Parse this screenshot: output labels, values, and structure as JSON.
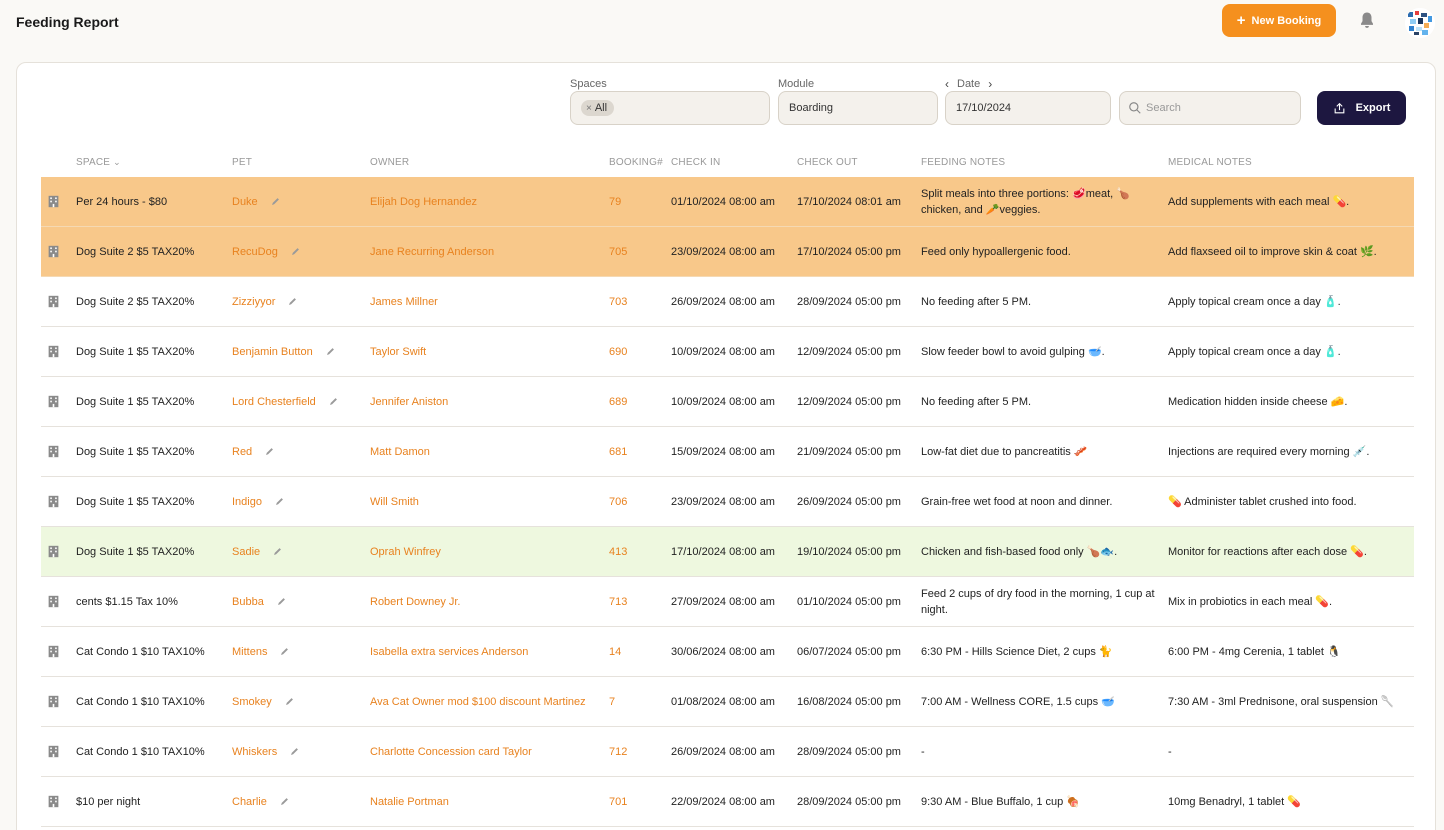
{
  "header": {
    "title": "Feeding Report",
    "new_booking_label": "New Booking"
  },
  "filters": {
    "spaces_label": "Spaces",
    "spaces_chip": "All",
    "module_label": "Module",
    "module_value": "Boarding",
    "date_label": "Date",
    "date_value": "17/10/2024",
    "search_placeholder": "Search",
    "export_label": "Export"
  },
  "columns": {
    "space": "SPACE",
    "pet": "PET",
    "owner": "OWNER",
    "booking": "BOOKING#",
    "check_in": "CHECK IN",
    "check_out": "CHECK OUT",
    "feeding_notes": "FEEDING NOTES",
    "medical_notes": "MEDICAL NOTES"
  },
  "colors": {
    "accent": "#f5901e",
    "link": "#e8821f",
    "export_bg": "#1d1740",
    "row_highlight_orange": "#f8c88a",
    "row_highlight_green": "#eef8df"
  },
  "rows": [
    {
      "space": "Per 24 hours - $80",
      "pet": "Duke",
      "owner": "Elijah Dog Hernandez",
      "booking": "79",
      "check_in": "01/10/2024 08:00 am",
      "check_out": "17/10/2024 08:01 am",
      "feeding_notes": "Split meals into three portions: 🥩meat, 🍗 chicken, and 🥕veggies.",
      "medical_notes": "Add supplements with each meal 💊.",
      "highlight": "orange"
    },
    {
      "space": "Dog Suite 2 $5 TAX20%",
      "pet": "RecuDog",
      "owner": "Jane Recurring Anderson",
      "booking": "705",
      "check_in": "23/09/2024 08:00 am",
      "check_out": "17/10/2024 05:00 pm",
      "feeding_notes": "Feed only hypoallergenic food.",
      "medical_notes": "Add flaxseed oil to improve skin & coat 🌿.",
      "highlight": "orange"
    },
    {
      "space": "Dog Suite 2 $5 TAX20%",
      "pet": "Zizziyyor",
      "owner": "James Millner",
      "booking": "703",
      "check_in": "26/09/2024 08:00 am",
      "check_out": "28/09/2024 05:00 pm",
      "feeding_notes": "No feeding after 5 PM.",
      "medical_notes": "Apply topical cream once a day 🧴.",
      "highlight": ""
    },
    {
      "space": "Dog Suite 1 $5 TAX20%",
      "pet": "Benjamin Button",
      "owner": "Taylor Swift",
      "booking": "690",
      "check_in": "10/09/2024 08:00 am",
      "check_out": "12/09/2024 05:00 pm",
      "feeding_notes": "Slow feeder bowl to avoid gulping 🥣.",
      "medical_notes": "Apply topical cream once a day 🧴.",
      "highlight": ""
    },
    {
      "space": "Dog Suite 1 $5 TAX20%",
      "pet": "Lord Chesterfield",
      "owner": "Jennifer Aniston",
      "booking": "689",
      "check_in": "10/09/2024 08:00 am",
      "check_out": "12/09/2024 05:00 pm",
      "feeding_notes": "No feeding after 5 PM.",
      "medical_notes": "Medication hidden inside cheese 🧀.",
      "highlight": ""
    },
    {
      "space": "Dog Suite 1 $5 TAX20%",
      "pet": "Red",
      "owner": "Matt Damon",
      "booking": "681",
      "check_in": "15/09/2024 08:00 am",
      "check_out": "21/09/2024 05:00 pm",
      "feeding_notes": "Low-fat diet due to pancreatitis 🥓",
      "medical_notes": "Injections are required every morning 💉.",
      "highlight": ""
    },
    {
      "space": "Dog Suite 1 $5 TAX20%",
      "pet": "Indigo",
      "owner": "Will Smith",
      "booking": "706",
      "check_in": "23/09/2024 08:00 am",
      "check_out": "26/09/2024 05:00 pm",
      "feeding_notes": "Grain-free wet food at noon and dinner.",
      "medical_notes": "💊 Administer tablet crushed into food.",
      "highlight": ""
    },
    {
      "space": "Dog Suite 1 $5 TAX20%",
      "pet": "Sadie",
      "owner": "Oprah Winfrey",
      "booking": "413",
      "check_in": "17/10/2024 08:00 am",
      "check_out": "19/10/2024 05:00 pm",
      "feeding_notes": "Chicken and fish-based food only 🍗🐟.",
      "medical_notes": "Monitor for reactions after each dose 💊.",
      "highlight": "green"
    },
    {
      "space": "cents $1.15 Tax 10%",
      "pet": "Bubba",
      "owner": "Robert Downey Jr.",
      "booking": "713",
      "check_in": "27/09/2024 08:00 am",
      "check_out": "01/10/2024 05:00 pm",
      "feeding_notes": "Feed 2 cups of dry food in the morning, 1 cup at night.",
      "medical_notes": "Mix in probiotics in each meal 💊.",
      "highlight": ""
    },
    {
      "space": "Cat Condo 1 $10 TAX10%",
      "pet": "Mittens",
      "owner": "Isabella extra services Anderson",
      "booking": "14",
      "check_in": "30/06/2024 08:00 am",
      "check_out": "06/07/2024 05:00 pm",
      "feeding_notes": "6:30 PM - Hills Science Diet, 2 cups 🐈",
      "medical_notes": "6:00 PM - 4mg Cerenia, 1 tablet 🐧",
      "highlight": ""
    },
    {
      "space": "Cat Condo 1 $10 TAX10%",
      "pet": "Smokey",
      "owner": "Ava Cat Owner mod $100 discount Martinez",
      "booking": "7",
      "check_in": "01/08/2024 08:00 am",
      "check_out": "16/08/2024 05:00 pm",
      "feeding_notes": "7:00 AM - Wellness CORE, 1.5 cups 🥣",
      "medical_notes": "7:30 AM - 3ml Prednisone, oral suspension 🥄",
      "highlight": ""
    },
    {
      "space": "Cat Condo 1 $10 TAX10%",
      "pet": "Whiskers",
      "owner": "Charlotte Concession card Taylor",
      "booking": "712",
      "check_in": "26/09/2024 08:00 am",
      "check_out": "28/09/2024 05:00 pm",
      "feeding_notes": "-",
      "medical_notes": "-",
      "highlight": ""
    },
    {
      "space": "$10 per night",
      "pet": "Charlie",
      "owner": "Natalie Portman",
      "booking": "701",
      "check_in": "22/09/2024 08:00 am",
      "check_out": "28/09/2024 05:00 pm",
      "feeding_notes": "9:30 AM - Blue Buffalo, 1 cup 🍖",
      "medical_notes": "10mg Benadryl, 1 tablet 💊",
      "highlight": ""
    }
  ]
}
